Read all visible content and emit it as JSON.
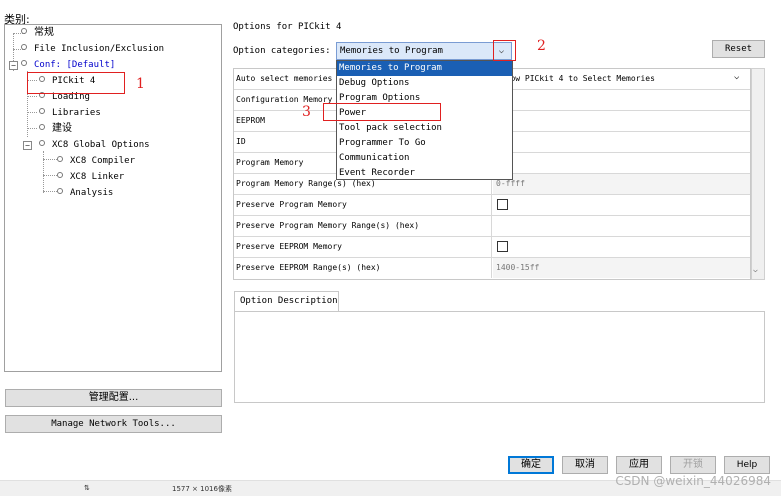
{
  "left": {
    "category_label": "类别:",
    "tree": {
      "normal": "常规",
      "file_inclusion": "File Inclusion/Exclusion",
      "conf": "Conf: [Default]",
      "pickit": "PICkit 4",
      "loading": "Loading",
      "libraries": "Libraries",
      "build": "建设",
      "xc8_global": "XC8 Global Options",
      "xc8_compiler": "XC8 Compiler",
      "xc8_linker": "XC8 Linker",
      "analysis": "Analysis"
    },
    "manage_config": "管理配置...",
    "manage_network": "Manage Network Tools..."
  },
  "right": {
    "title": "Options for PICkit 4",
    "option_categories_label": "Option categories:",
    "option_categories_value": "Memories to Program",
    "reset": "Reset",
    "rows": [
      {
        "name": "Auto select memories and ranges",
        "value": "Allow PICkit 4 to Select Memories",
        "type": "select"
      },
      {
        "name": "Configuration Memory",
        "value": "",
        "type": "text"
      },
      {
        "name": "EEPROM",
        "value": "",
        "type": "text"
      },
      {
        "name": "ID",
        "value": "",
        "type": "text"
      },
      {
        "name": "Program Memory",
        "value": "",
        "type": "text"
      },
      {
        "name": "Program Memory Range(s) (hex)",
        "value": "0-ffff",
        "type": "grey"
      },
      {
        "name": "Preserve Program Memory",
        "value": "",
        "type": "check"
      },
      {
        "name": "Preserve Program Memory Range(s) (hex)",
        "value": "",
        "type": "text"
      },
      {
        "name": "Preserve EEPROM Memory",
        "value": "",
        "type": "check"
      },
      {
        "name": "Preserve EEPROM Range(s) (hex)",
        "value": "1400-15ff",
        "type": "grey"
      }
    ],
    "desc_tab": "Option Description",
    "dropdown_items": [
      "Memories to Program",
      "Debug Options",
      "Program Options",
      "Power",
      "Tool pack selection",
      "Programmer To Go",
      "Communication",
      "Event Recorder"
    ]
  },
  "annotations": {
    "n1": "1",
    "n2": "2",
    "n3": "3"
  },
  "buttons": {
    "ok": "确定",
    "cancel": "取消",
    "apply": "应用",
    "open": "开锁",
    "help": "Help"
  },
  "statusbar": {
    "left_icon": "⇅",
    "dims": "1577 × 1016像素"
  },
  "watermark": "CSDN @weixin_44026984",
  "icons": {
    "dropdown_arrow": "chevron-down-icon",
    "tree_node": "circle-bullet-icon",
    "collapse": "minus-expander-icon"
  },
  "colors": {
    "selection": "#1a5fb4",
    "annotation": "#e02020",
    "link": "#0000cc"
  }
}
